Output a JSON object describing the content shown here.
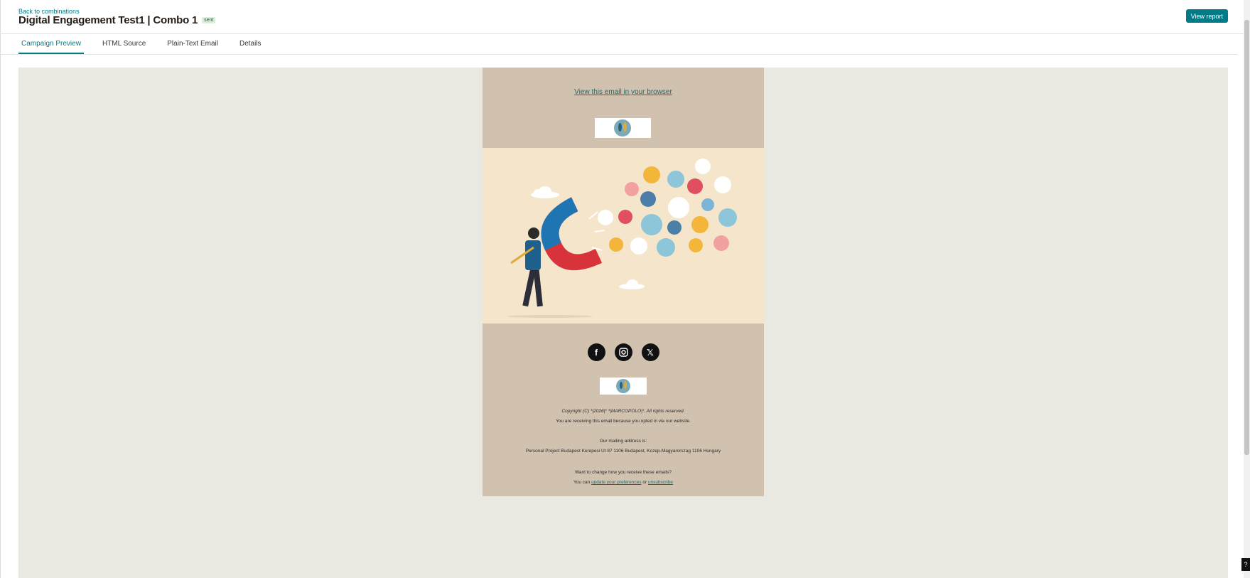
{
  "header": {
    "back_link": "Back to combinations",
    "title": "Digital Engagement Test1 | Combo 1",
    "status_badge": "sent",
    "view_report": "View report"
  },
  "tabs": [
    {
      "label": "Campaign Preview",
      "active": true
    },
    {
      "label": "HTML Source",
      "active": false
    },
    {
      "label": "Plain-Text Email",
      "active": false
    },
    {
      "label": "Details",
      "active": false
    }
  ],
  "email": {
    "view_in_browser": "View this email in your browser",
    "social_icons": [
      "facebook-icon",
      "instagram-icon",
      "x-icon"
    ],
    "copyright": "Copyright (C) *|2026|* *|MARCOPOLO|*. All rights reserved.",
    "opted_in": "You are receiving this email because you opted in via our website.",
    "mailing_label": "Our mailing address is:",
    "address": "Personal Project Budapest Kerepesi Ut 87 1106 Budapest, Kozep-Magyarorszag 1106 Hungary",
    "change_question": "Want to change how you receive these emails?",
    "you_can": "You can",
    "update_prefs": "update your preferences",
    "or": "or",
    "unsubscribe": "unsubscribe"
  },
  "help_label": "?",
  "colors": {
    "accent": "#007c89",
    "canvas": "#e9e9e1",
    "email_frame": "#d1c2b0",
    "hero_bg": "#f5e5cb"
  }
}
